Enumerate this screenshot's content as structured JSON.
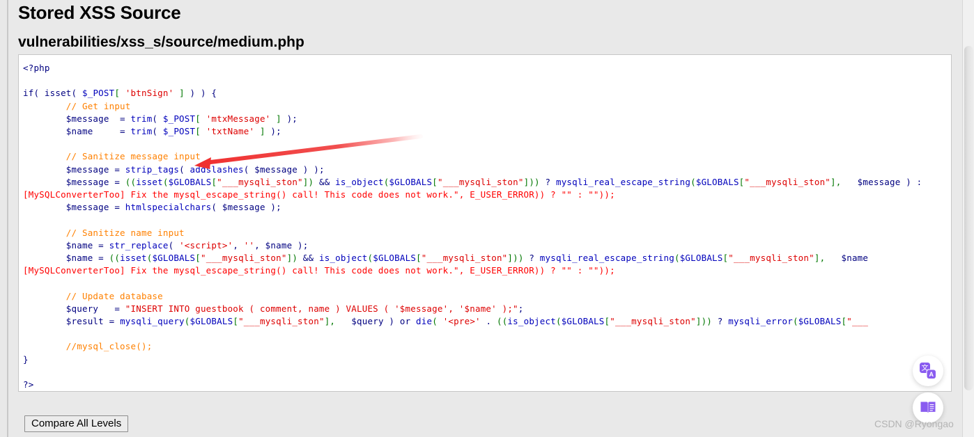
{
  "page": {
    "title": "Stored XSS Source",
    "file_path": "vulnerabilities/xss_s/source/medium.php",
    "background_color": "#e9e9e9"
  },
  "code": {
    "language": "php",
    "lines": [
      [
        {
          "t": "<?php",
          "c": "default"
        }
      ],
      [
        {
          "t": "",
          "c": "default"
        }
      ],
      [
        {
          "t": "if( ",
          "c": "keyword"
        },
        {
          "t": "isset( ",
          "c": "keyword"
        },
        {
          "t": "$_POST",
          "c": "func"
        },
        {
          "t": "[ ",
          "c": "bracket"
        },
        {
          "t": "'btnSign'",
          "c": "string"
        },
        {
          "t": " ]",
          "c": "bracket"
        },
        {
          "t": " ) ) {",
          "c": "keyword"
        }
      ],
      [
        {
          "t": "        // Get input",
          "c": "comment"
        }
      ],
      [
        {
          "t": "        $message  = ",
          "c": "keyword"
        },
        {
          "t": "trim",
          "c": "func"
        },
        {
          "t": "( ",
          "c": "keyword"
        },
        {
          "t": "$_POST",
          "c": "func"
        },
        {
          "t": "[ ",
          "c": "bracket"
        },
        {
          "t": "'mtxMessage'",
          "c": "string"
        },
        {
          "t": " ]",
          "c": "bracket"
        },
        {
          "t": " );",
          "c": "keyword"
        }
      ],
      [
        {
          "t": "        $name     = ",
          "c": "keyword"
        },
        {
          "t": "trim",
          "c": "func"
        },
        {
          "t": "( ",
          "c": "keyword"
        },
        {
          "t": "$_POST",
          "c": "func"
        },
        {
          "t": "[ ",
          "c": "bracket"
        },
        {
          "t": "'txtName'",
          "c": "string"
        },
        {
          "t": " ]",
          "c": "bracket"
        },
        {
          "t": " );",
          "c": "keyword"
        }
      ],
      [
        {
          "t": "",
          "c": "default"
        }
      ],
      [
        {
          "t": "        // Sanitize message input",
          "c": "comment"
        }
      ],
      [
        {
          "t": "        $message = ",
          "c": "keyword"
        },
        {
          "t": "strip_tags",
          "c": "func"
        },
        {
          "t": "( ",
          "c": "keyword"
        },
        {
          "t": "addslashes",
          "c": "func"
        },
        {
          "t": "( $message ) );",
          "c": "keyword"
        }
      ],
      [
        {
          "t": "        $message = ",
          "c": "keyword"
        },
        {
          "t": "((",
          "c": "bracket"
        },
        {
          "t": "isset",
          "c": "func"
        },
        {
          "t": "(",
          "c": "bracket"
        },
        {
          "t": "$GLOBALS",
          "c": "func"
        },
        {
          "t": "[",
          "c": "bracket"
        },
        {
          "t": "\"___mysqli_ston\"",
          "c": "string"
        },
        {
          "t": "])",
          "c": "bracket"
        },
        {
          "t": " && ",
          "c": "keyword"
        },
        {
          "t": "is_object",
          "c": "func"
        },
        {
          "t": "(",
          "c": "bracket"
        },
        {
          "t": "$GLOBALS",
          "c": "func"
        },
        {
          "t": "[",
          "c": "bracket"
        },
        {
          "t": "\"___mysqli_ston\"",
          "c": "string"
        },
        {
          "t": "]))",
          "c": "bracket"
        },
        {
          "t": " ? ",
          "c": "keyword"
        },
        {
          "t": "mysqli_real_escape_string",
          "c": "func"
        },
        {
          "t": "(",
          "c": "bracket"
        },
        {
          "t": "$GLOBALS",
          "c": "func"
        },
        {
          "t": "[",
          "c": "bracket"
        },
        {
          "t": "\"___mysqli_ston\"",
          "c": "string"
        },
        {
          "t": "],",
          "c": "bracket"
        },
        {
          "t": "   $message ) : ",
          "c": "keyword"
        }
      ],
      [
        {
          "t": "[MySQLConverterToo] Fix the mysql_escape_string() call! This code does not work.\", E_USER_ERROR)) ? \"\" : \"\"));",
          "c": "err"
        }
      ],
      [
        {
          "t": "        $message = ",
          "c": "keyword"
        },
        {
          "t": "htmlspecialchars",
          "c": "func"
        },
        {
          "t": "( $message );",
          "c": "keyword"
        }
      ],
      [
        {
          "t": "",
          "c": "default"
        }
      ],
      [
        {
          "t": "        // Sanitize name input",
          "c": "comment"
        }
      ],
      [
        {
          "t": "        $name = ",
          "c": "keyword"
        },
        {
          "t": "str_replace",
          "c": "func"
        },
        {
          "t": "( ",
          "c": "keyword"
        },
        {
          "t": "'<script>'",
          "c": "string"
        },
        {
          "t": ", ",
          "c": "keyword"
        },
        {
          "t": "''",
          "c": "string"
        },
        {
          "t": ", $name );",
          "c": "keyword"
        }
      ],
      [
        {
          "t": "        $name = ",
          "c": "keyword"
        },
        {
          "t": "((",
          "c": "bracket"
        },
        {
          "t": "isset",
          "c": "func"
        },
        {
          "t": "(",
          "c": "bracket"
        },
        {
          "t": "$GLOBALS",
          "c": "func"
        },
        {
          "t": "[",
          "c": "bracket"
        },
        {
          "t": "\"___mysqli_ston\"",
          "c": "string"
        },
        {
          "t": "])",
          "c": "bracket"
        },
        {
          "t": " && ",
          "c": "keyword"
        },
        {
          "t": "is_object",
          "c": "func"
        },
        {
          "t": "(",
          "c": "bracket"
        },
        {
          "t": "$GLOBALS",
          "c": "func"
        },
        {
          "t": "[",
          "c": "bracket"
        },
        {
          "t": "\"___mysqli_ston\"",
          "c": "string"
        },
        {
          "t": "]))",
          "c": "bracket"
        },
        {
          "t": " ? ",
          "c": "keyword"
        },
        {
          "t": "mysqli_real_escape_string",
          "c": "func"
        },
        {
          "t": "(",
          "c": "bracket"
        },
        {
          "t": "$GLOBALS",
          "c": "func"
        },
        {
          "t": "[",
          "c": "bracket"
        },
        {
          "t": "\"___mysqli_ston\"",
          "c": "string"
        },
        {
          "t": "],",
          "c": "bracket"
        },
        {
          "t": "   $name",
          "c": "keyword"
        }
      ],
      [
        {
          "t": "[MySQLConverterToo] Fix the mysql_escape_string() call! This code does not work.\", E_USER_ERROR)) ? \"\" : \"\"));",
          "c": "err"
        }
      ],
      [
        {
          "t": "",
          "c": "default"
        }
      ],
      [
        {
          "t": "        // Update database",
          "c": "comment"
        }
      ],
      [
        {
          "t": "        $query   = ",
          "c": "keyword"
        },
        {
          "t": "\"INSERT INTO guestbook ( comment, name ) VALUES ( '$message', '$name' );\"",
          "c": "string"
        },
        {
          "t": ";",
          "c": "keyword"
        }
      ],
      [
        {
          "t": "        $result = ",
          "c": "keyword"
        },
        {
          "t": "mysqli_query",
          "c": "func"
        },
        {
          "t": "(",
          "c": "bracket"
        },
        {
          "t": "$GLOBALS",
          "c": "func"
        },
        {
          "t": "[",
          "c": "bracket"
        },
        {
          "t": "\"___mysqli_ston\"",
          "c": "string"
        },
        {
          "t": "],",
          "c": "bracket"
        },
        {
          "t": "   $query ) ",
          "c": "keyword"
        },
        {
          "t": "or ",
          "c": "keyword"
        },
        {
          "t": "die",
          "c": "func"
        },
        {
          "t": "( ",
          "c": "bracket"
        },
        {
          "t": "'<pre>'",
          "c": "string"
        },
        {
          "t": " . ",
          "c": "keyword"
        },
        {
          "t": "((",
          "c": "bracket"
        },
        {
          "t": "is_object",
          "c": "func"
        },
        {
          "t": "(",
          "c": "bracket"
        },
        {
          "t": "$GLOBALS",
          "c": "func"
        },
        {
          "t": "[",
          "c": "bracket"
        },
        {
          "t": "\"___mysqli_ston\"",
          "c": "string"
        },
        {
          "t": "]))",
          "c": "bracket"
        },
        {
          "t": " ? ",
          "c": "keyword"
        },
        {
          "t": "mysqli_error",
          "c": "func"
        },
        {
          "t": "(",
          "c": "bracket"
        },
        {
          "t": "$GLOBALS",
          "c": "func"
        },
        {
          "t": "[",
          "c": "bracket"
        },
        {
          "t": "\"___",
          "c": "string"
        }
      ],
      [
        {
          "t": "",
          "c": "default"
        }
      ],
      [
        {
          "t": "        //mysql_close();",
          "c": "comment"
        }
      ],
      [
        {
          "t": "}",
          "c": "keyword"
        }
      ],
      [
        {
          "t": "",
          "c": "default"
        }
      ],
      [
        {
          "t": "?>",
          "c": "default"
        }
      ]
    ]
  },
  "buttons": {
    "compare_all_levels": "Compare All Levels"
  },
  "annotation": {
    "arrow_color": "#f03030",
    "points_to": "strip_tags"
  },
  "floating_buttons": [
    {
      "name": "translate-icon",
      "color": "#8a5cf0"
    },
    {
      "name": "book-icon",
      "color": "#8a5cf0"
    }
  ],
  "watermark": {
    "text": "CSDN @Ryongao",
    "color": "#b4b4b4"
  },
  "scrollbar": {
    "present": true
  }
}
